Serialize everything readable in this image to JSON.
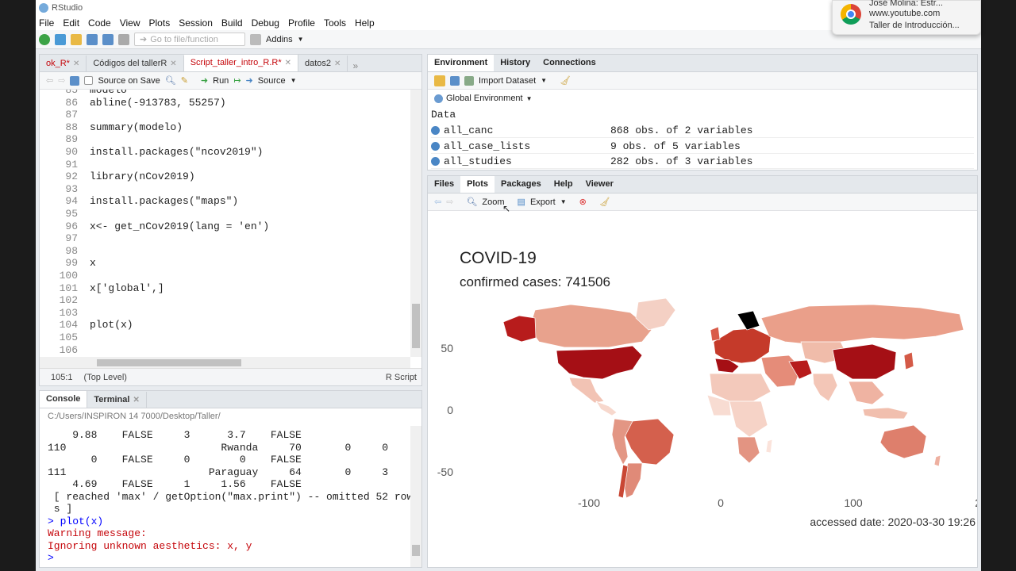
{
  "window": {
    "title": "RStudio"
  },
  "menu": [
    "File",
    "Edit",
    "Code",
    "View",
    "Plots",
    "Session",
    "Build",
    "Debug",
    "Profile",
    "Tools",
    "Help"
  ],
  "toolbar": {
    "goto_placeholder": "Go to file/function",
    "addins": "Addins"
  },
  "editor": {
    "tabs": [
      {
        "label": "ok_R*",
        "active": false
      },
      {
        "label": "Códigos del tallerR",
        "active": false
      },
      {
        "label": "Script_taller_intro_R.R*",
        "active": true
      },
      {
        "label": "datos2",
        "active": false
      }
    ],
    "source_on_save": "Source on Save",
    "run": "Run",
    "source": "Source",
    "lines": [
      {
        "n": "85",
        "code": "modelo"
      },
      {
        "n": "86",
        "code": "abline(-913783, 55257)"
      },
      {
        "n": "87",
        "code": ""
      },
      {
        "n": "88",
        "code": "summary(modelo)"
      },
      {
        "n": "89",
        "code": ""
      },
      {
        "n": "90",
        "code": "install.packages(\"ncov2019\")"
      },
      {
        "n": "91",
        "code": ""
      },
      {
        "n": "92",
        "code": "library(nCov2019)"
      },
      {
        "n": "93",
        "code": ""
      },
      {
        "n": "94",
        "code": "install.packages(\"maps\")"
      },
      {
        "n": "95",
        "code": ""
      },
      {
        "n": "96",
        "code": "x<- get_nCov2019(lang = 'en')"
      },
      {
        "n": "97",
        "code": ""
      },
      {
        "n": "98",
        "code": ""
      },
      {
        "n": "99",
        "code": "x"
      },
      {
        "n": "100",
        "code": ""
      },
      {
        "n": "101",
        "code": "x['global',]"
      },
      {
        "n": "102",
        "code": ""
      },
      {
        "n": "103",
        "code": ""
      },
      {
        "n": "104",
        "code": "plot(x)"
      },
      {
        "n": "105",
        "code": ""
      },
      {
        "n": "106",
        "code": ""
      }
    ],
    "status_pos": "105:1",
    "status_level": "(Top Level)",
    "status_type": "R Script"
  },
  "console": {
    "tabs": [
      "Console",
      "Terminal"
    ],
    "path": "C:/Users/INSPIRON 14 7000/Desktop/Taller/",
    "lines": [
      {
        "t": "    9.88    FALSE     3      3.7    FALSE",
        "c": ""
      },
      {
        "t": "110                         Rwanda     70       0     0",
        "c": ""
      },
      {
        "t": "       0    FALSE     0        0    FALSE",
        "c": ""
      },
      {
        "t": "111                       Paraguay     64       0     3",
        "c": ""
      },
      {
        "t": "    4.69    FALSE     1     1.56    FALSE",
        "c": ""
      },
      {
        "t": " [ reached 'max' / getOption(\"max.print\") -- omitted 52 row",
        "c": ""
      },
      {
        "t": " s ]",
        "c": ""
      },
      {
        "t": "> plot(x)",
        "c": "blue"
      },
      {
        "t": "Warning message:",
        "c": "red"
      },
      {
        "t": "Ignoring unknown aesthetics: x, y",
        "c": "red"
      },
      {
        "t": "> ",
        "c": "blue"
      }
    ]
  },
  "environment": {
    "tabs": [
      "Environment",
      "History",
      "Connections"
    ],
    "import": "Import Dataset",
    "scope": "Global Environment",
    "section": "Data",
    "rows": [
      {
        "name": "all_canc",
        "value": "868 obs. of 2 variables"
      },
      {
        "name": "all_case_lists",
        "value": "9 obs. of 5 variables"
      },
      {
        "name": "all_studies",
        "value": "282 obs. of 3 variables"
      }
    ]
  },
  "plots": {
    "tabs": [
      "Files",
      "Plots",
      "Packages",
      "Help",
      "Viewer"
    ],
    "zoom": "Zoom",
    "export": "Export"
  },
  "chart_data": {
    "type": "choropleth-map",
    "title": "COVID-19",
    "subtitle": "confirmed cases: 741506",
    "caption": "accessed date: 2020-03-30 19:26",
    "yticks": [
      "50",
      "0",
      "-50"
    ],
    "xticks": [
      "-100",
      "0",
      "100",
      "2"
    ],
    "fill_low": "#fce4dc",
    "fill_high": "#a50f15",
    "grid": false
  },
  "notification": {
    "title": "José Molina: Estr...",
    "site": "www.youtube.com",
    "text": "Taller de Introducción..."
  }
}
